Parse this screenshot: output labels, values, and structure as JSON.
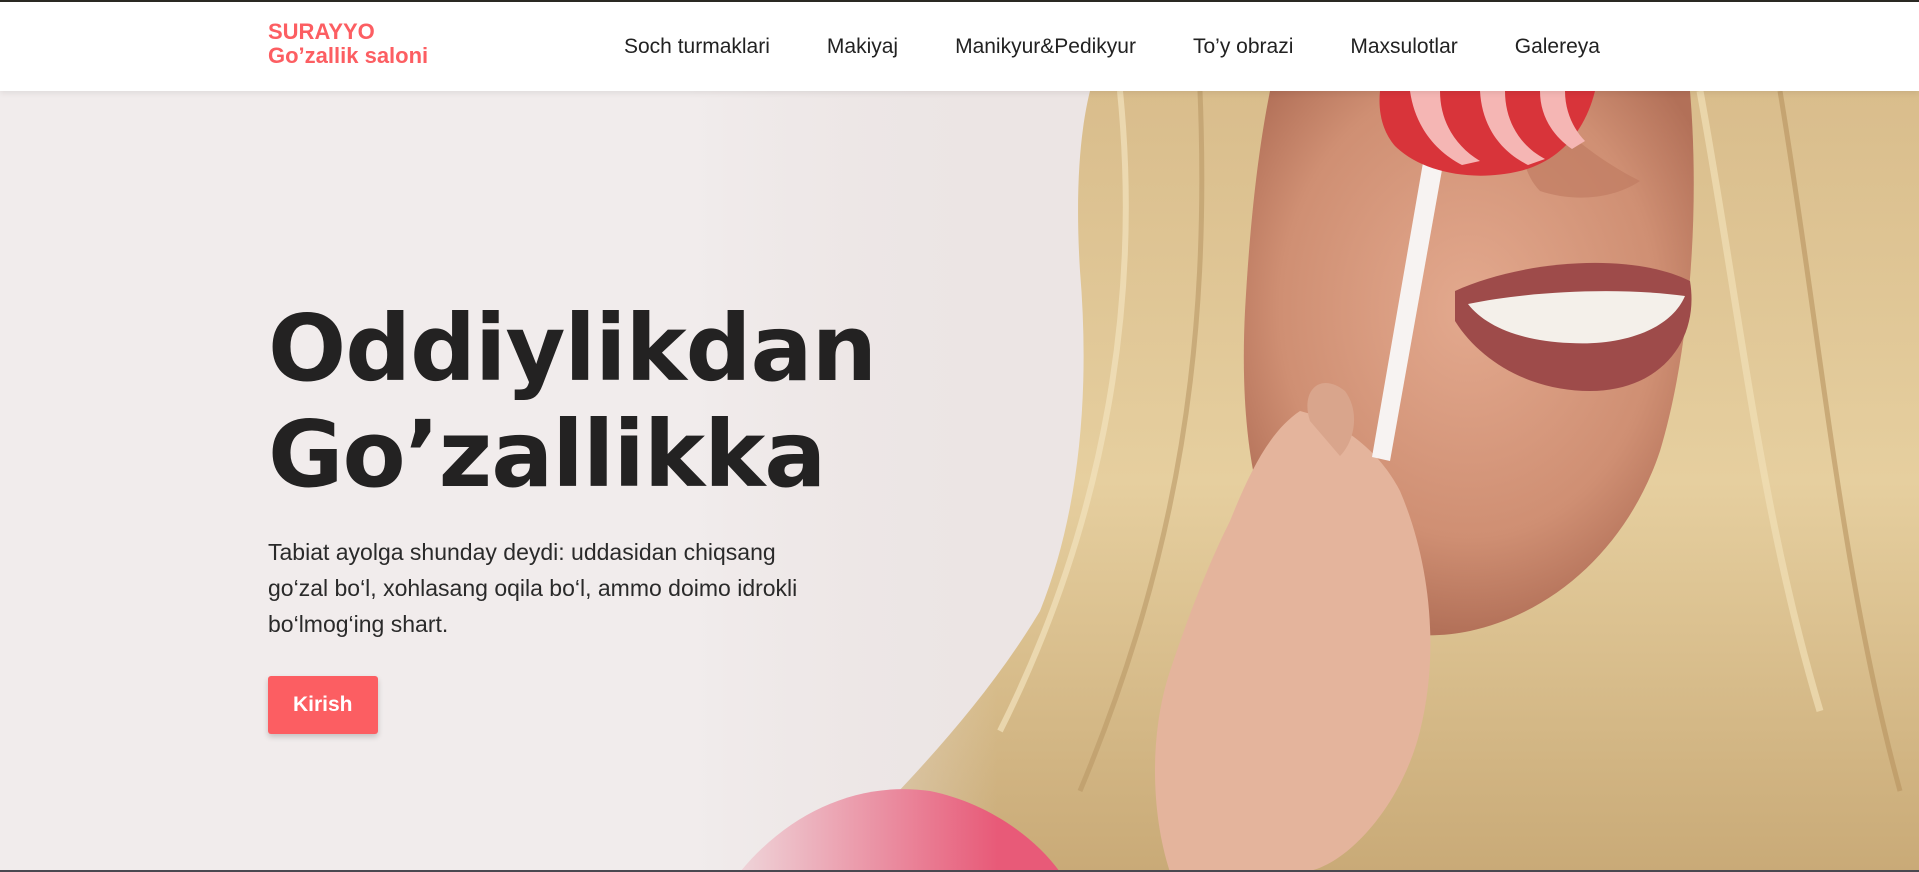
{
  "logo": {
    "line1": "SURAYYO",
    "line2": "Go’zallik saloni"
  },
  "nav": {
    "items": [
      {
        "label": "Soch turmaklari"
      },
      {
        "label": "Makiyaj"
      },
      {
        "label": "Manikyur&Pedikyur"
      },
      {
        "label": "To’y obrazi"
      },
      {
        "label": "Maxsulotlar"
      },
      {
        "label": "Galereya"
      }
    ]
  },
  "hero": {
    "title_line1": "Oddiylikdan",
    "title_line2": "Go’zallikka",
    "description": "Tabiat ayolga shunday deydi: uddasidan chiqsang go‘zal bo‘l, xohlasang oqila bo‘l, ammo doimo idrokli bo‘lmog‘ing shart.",
    "button_label": "Kirish"
  },
  "colors": {
    "accent": "#fc5e62",
    "text_dark": "#232222",
    "hero_bg": "#f1ecec"
  }
}
